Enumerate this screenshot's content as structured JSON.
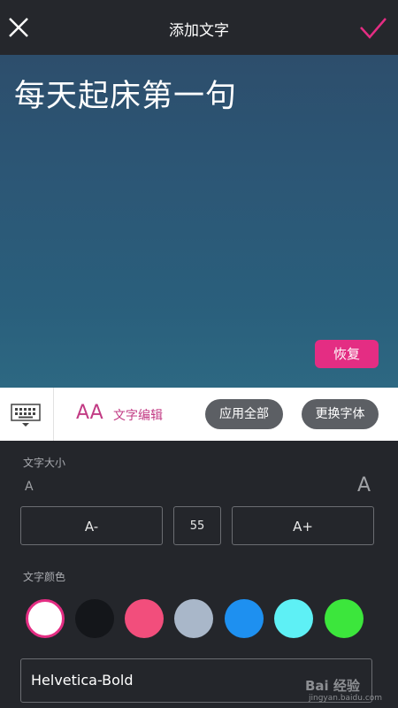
{
  "header": {
    "title": "添加文字",
    "close_icon": "close-icon",
    "confirm_icon": "checkmark-icon",
    "accent": "#e42d83"
  },
  "preview": {
    "text": "每天起床第一句",
    "restore_label": "恢复"
  },
  "toolbar": {
    "keyboard_icon": "keyboard-icon",
    "edit_icon_text": "AA",
    "edit_label": "文字编辑",
    "apply_all_label": "应用全部",
    "change_font_label": "更换字体"
  },
  "size": {
    "label": "文字大小",
    "small_indicator": "A",
    "large_indicator": "A",
    "decrease_label": "A-",
    "value": "55",
    "increase_label": "A+"
  },
  "color": {
    "label": "文字颜色",
    "swatches": [
      "#ffffff",
      "#14161a",
      "#f24e7c",
      "#a9b7c9",
      "#1e90f0",
      "#5ef0f5",
      "#3ce63c"
    ],
    "selected": 0
  },
  "font": {
    "current": "Helvetica-Bold"
  },
  "watermark": {
    "text": "Bai 经验",
    "sub": "jingyan.baidu.com"
  }
}
